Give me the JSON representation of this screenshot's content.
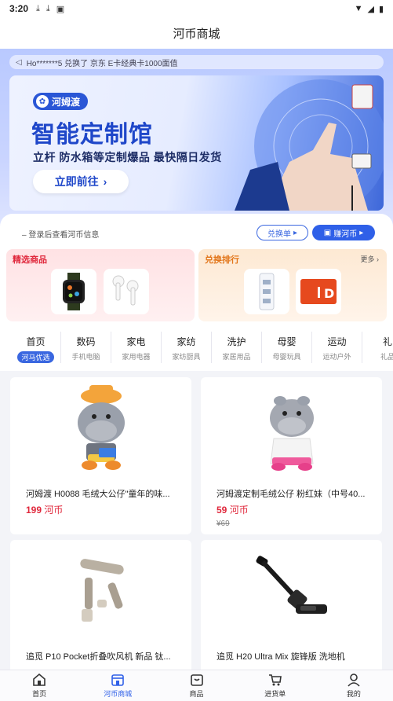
{
  "status_bar": {
    "time": "3:20"
  },
  "header": {
    "title": "河币商城"
  },
  "ticker": {
    "text": "Ho*******5 兑换了 京东 E卡经典卡1000面值"
  },
  "banner": {
    "brand": "河姆渡",
    "title": "智能定制馆",
    "subtitle": "立杆 防水箱等定制爆品 最快隔日发货",
    "button": "立即前往"
  },
  "account": {
    "login_tip": "– 登录后查看河币信息",
    "exchange_button": "兑换单",
    "earn_button": "赚河币"
  },
  "promos": {
    "left_title": "精选商品",
    "right_title": "兑换排行",
    "right_more": "更多"
  },
  "categories": [
    {
      "title": "首页",
      "sub": "河马优选"
    },
    {
      "title": "数码",
      "sub": "手机电脑"
    },
    {
      "title": "家电",
      "sub": "家用电器"
    },
    {
      "title": "家纺",
      "sub": "家纺厨具"
    },
    {
      "title": "洗护",
      "sub": "家居用品"
    },
    {
      "title": "母婴",
      "sub": "母婴玩具"
    },
    {
      "title": "运动",
      "sub": "运动户外"
    },
    {
      "title": "礼",
      "sub": "礼品"
    }
  ],
  "products": [
    {
      "name": "河姆渡 H0088 毛绒大公仔\"童年的味...",
      "price": "199",
      "unit": "河币",
      "original": ""
    },
    {
      "name": "河姆渡定制毛绒公仔 粉红妹（中号40...",
      "price": "59",
      "unit": "河币",
      "original": "¥69"
    },
    {
      "name": "追觅 P10 Pocket折叠吹风机 新品 钛...",
      "price": "",
      "unit": "",
      "original": ""
    },
    {
      "name": "追觅 H20 Ultra Mix 旋锋版 洗地机",
      "price": "",
      "unit": "",
      "original": ""
    }
  ],
  "tabbar": {
    "home": "首页",
    "mall": "河币商城",
    "goods": "商品",
    "cart": "进货单",
    "mine": "我的"
  },
  "colors": {
    "accent": "#2f60e8",
    "price": "#e0283c",
    "rank": "#e2761a"
  }
}
